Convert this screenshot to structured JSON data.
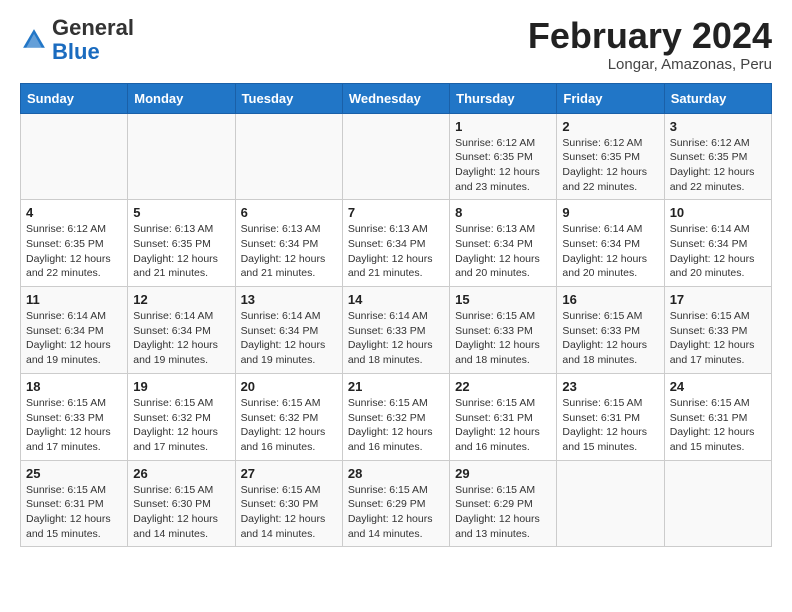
{
  "header": {
    "logo_general": "General",
    "logo_blue": "Blue",
    "month_title": "February 2024",
    "location": "Longar, Amazonas, Peru"
  },
  "days_of_week": [
    "Sunday",
    "Monday",
    "Tuesday",
    "Wednesday",
    "Thursday",
    "Friday",
    "Saturday"
  ],
  "weeks": [
    [
      {
        "day": "",
        "info": ""
      },
      {
        "day": "",
        "info": ""
      },
      {
        "day": "",
        "info": ""
      },
      {
        "day": "",
        "info": ""
      },
      {
        "day": "1",
        "info": "Sunrise: 6:12 AM\nSunset: 6:35 PM\nDaylight: 12 hours and 23 minutes."
      },
      {
        "day": "2",
        "info": "Sunrise: 6:12 AM\nSunset: 6:35 PM\nDaylight: 12 hours and 22 minutes."
      },
      {
        "day": "3",
        "info": "Sunrise: 6:12 AM\nSunset: 6:35 PM\nDaylight: 12 hours and 22 minutes."
      }
    ],
    [
      {
        "day": "4",
        "info": "Sunrise: 6:12 AM\nSunset: 6:35 PM\nDaylight: 12 hours and 22 minutes."
      },
      {
        "day": "5",
        "info": "Sunrise: 6:13 AM\nSunset: 6:35 PM\nDaylight: 12 hours and 21 minutes."
      },
      {
        "day": "6",
        "info": "Sunrise: 6:13 AM\nSunset: 6:34 PM\nDaylight: 12 hours and 21 minutes."
      },
      {
        "day": "7",
        "info": "Sunrise: 6:13 AM\nSunset: 6:34 PM\nDaylight: 12 hours and 21 minutes."
      },
      {
        "day": "8",
        "info": "Sunrise: 6:13 AM\nSunset: 6:34 PM\nDaylight: 12 hours and 20 minutes."
      },
      {
        "day": "9",
        "info": "Sunrise: 6:14 AM\nSunset: 6:34 PM\nDaylight: 12 hours and 20 minutes."
      },
      {
        "day": "10",
        "info": "Sunrise: 6:14 AM\nSunset: 6:34 PM\nDaylight: 12 hours and 20 minutes."
      }
    ],
    [
      {
        "day": "11",
        "info": "Sunrise: 6:14 AM\nSunset: 6:34 PM\nDaylight: 12 hours and 19 minutes."
      },
      {
        "day": "12",
        "info": "Sunrise: 6:14 AM\nSunset: 6:34 PM\nDaylight: 12 hours and 19 minutes."
      },
      {
        "day": "13",
        "info": "Sunrise: 6:14 AM\nSunset: 6:34 PM\nDaylight: 12 hours and 19 minutes."
      },
      {
        "day": "14",
        "info": "Sunrise: 6:14 AM\nSunset: 6:33 PM\nDaylight: 12 hours and 18 minutes."
      },
      {
        "day": "15",
        "info": "Sunrise: 6:15 AM\nSunset: 6:33 PM\nDaylight: 12 hours and 18 minutes."
      },
      {
        "day": "16",
        "info": "Sunrise: 6:15 AM\nSunset: 6:33 PM\nDaylight: 12 hours and 18 minutes."
      },
      {
        "day": "17",
        "info": "Sunrise: 6:15 AM\nSunset: 6:33 PM\nDaylight: 12 hours and 17 minutes."
      }
    ],
    [
      {
        "day": "18",
        "info": "Sunrise: 6:15 AM\nSunset: 6:33 PM\nDaylight: 12 hours and 17 minutes."
      },
      {
        "day": "19",
        "info": "Sunrise: 6:15 AM\nSunset: 6:32 PM\nDaylight: 12 hours and 17 minutes."
      },
      {
        "day": "20",
        "info": "Sunrise: 6:15 AM\nSunset: 6:32 PM\nDaylight: 12 hours and 16 minutes."
      },
      {
        "day": "21",
        "info": "Sunrise: 6:15 AM\nSunset: 6:32 PM\nDaylight: 12 hours and 16 minutes."
      },
      {
        "day": "22",
        "info": "Sunrise: 6:15 AM\nSunset: 6:31 PM\nDaylight: 12 hours and 16 minutes."
      },
      {
        "day": "23",
        "info": "Sunrise: 6:15 AM\nSunset: 6:31 PM\nDaylight: 12 hours and 15 minutes."
      },
      {
        "day": "24",
        "info": "Sunrise: 6:15 AM\nSunset: 6:31 PM\nDaylight: 12 hours and 15 minutes."
      }
    ],
    [
      {
        "day": "25",
        "info": "Sunrise: 6:15 AM\nSunset: 6:31 PM\nDaylight: 12 hours and 15 minutes."
      },
      {
        "day": "26",
        "info": "Sunrise: 6:15 AM\nSunset: 6:30 PM\nDaylight: 12 hours and 14 minutes."
      },
      {
        "day": "27",
        "info": "Sunrise: 6:15 AM\nSunset: 6:30 PM\nDaylight: 12 hours and 14 minutes."
      },
      {
        "day": "28",
        "info": "Sunrise: 6:15 AM\nSunset: 6:29 PM\nDaylight: 12 hours and 14 minutes."
      },
      {
        "day": "29",
        "info": "Sunrise: 6:15 AM\nSunset: 6:29 PM\nDaylight: 12 hours and 13 minutes."
      },
      {
        "day": "",
        "info": ""
      },
      {
        "day": "",
        "info": ""
      }
    ]
  ]
}
